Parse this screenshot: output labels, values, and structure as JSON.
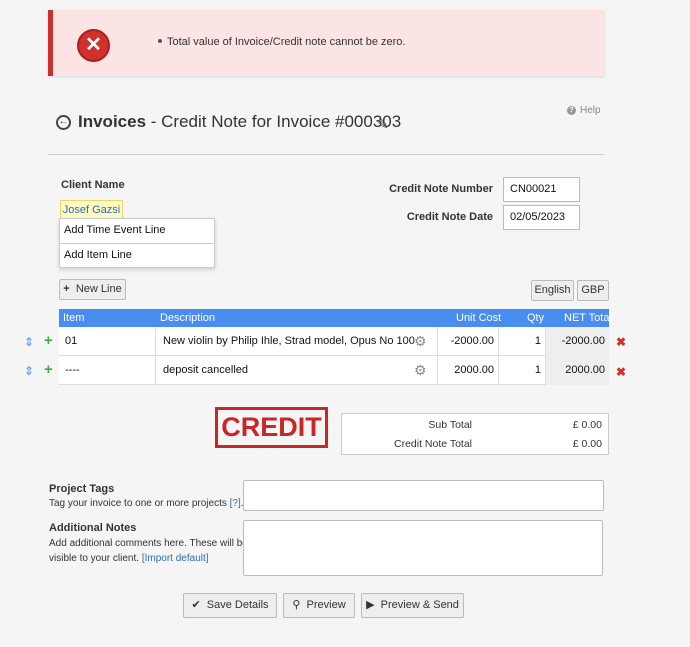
{
  "alert": {
    "message": "Total value of Invoice/Credit note cannot be zero."
  },
  "help_label": "Help",
  "header": {
    "section": "Invoices",
    "separator": " - ",
    "subtitle": "Credit Note for Invoice #000303"
  },
  "client": {
    "label": "Client Name",
    "value": "Josef Gazsi",
    "menu": [
      "Add Time Event Line",
      "Add Item Line"
    ]
  },
  "credit_note": {
    "number_label": "Credit Note Number",
    "number_value": "CN00021",
    "date_label": "Credit Note Date",
    "date_value": "02/05/2023"
  },
  "toolbar": {
    "new_line": "New Line",
    "language": "English",
    "currency": "GBP"
  },
  "table": {
    "headers": {
      "item": "Item",
      "description": "Description",
      "unit_cost": "Unit Cost",
      "qty": "Qty",
      "net_total": "NET Total"
    },
    "rows": [
      {
        "item": "01",
        "description": "New violin by Philip Ihle, Strad model, Opus No 100",
        "unit_cost": "-2000.00",
        "qty": "1",
        "net_total": "-2000.00"
      },
      {
        "item": "----",
        "description": "deposit cancelled",
        "unit_cost": "2000.00",
        "qty": "1",
        "net_total": "2000.00"
      }
    ]
  },
  "stamp": "CREDIT",
  "totals": {
    "sub_total_label": "Sub Total",
    "sub_total_value": "£ 0.00",
    "credit_total_label": "Credit Note Total",
    "credit_total_value": "£ 0.00"
  },
  "project_tags": {
    "label": "Project Tags",
    "help": "Tag your invoice to one or more projects",
    "help_link": "[?]",
    "help_suffix": "."
  },
  "notes": {
    "label": "Additional Notes",
    "help_line1": "Add additional comments here. These will be",
    "help_line2": "visible to your client.",
    "import_link": "[Import default]"
  },
  "actions": {
    "save": "Save Details",
    "preview": "Preview",
    "preview_send": "Preview & Send"
  },
  "colors": {
    "header_blue": "#4a8df0",
    "error_red": "#d0312d",
    "link_blue": "#2a6eb5"
  }
}
